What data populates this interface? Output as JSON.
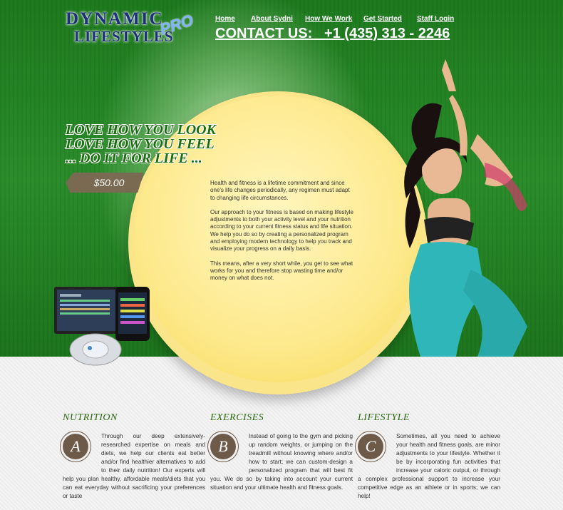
{
  "logo": {
    "line1": "DYNAMIC",
    "line2": "LIFESTYLES",
    "accent": "PRO"
  },
  "nav": {
    "items": [
      "Home",
      "About Sydni",
      "How We Work",
      "Get Started",
      "Staff Login"
    ]
  },
  "contact": "CONTACT US:   +1 (435) 313 - 2246",
  "tagline": [
    "LOVE HOW YOU LOOK",
    "LOVE HOW YOU FEEL",
    "... DO IT FOR LIFE ..."
  ],
  "price": "$50.00",
  "intro": [
    "Health and fitness is a lifetime commitment and since one's life changes periodically, any regimen must adapt to changing life circumstances.",
    "Our approach to your fitness is based on making lifestyle adjustments to both your activity level and your nutrition according to your current fitness status and life situation. We help you do so by creating a personalized program and employing modern technology to help you track and visualize your progress on a daily basis.",
    "This means, after a very short while, you get to see what works for you and therefore stop wasting time and/or money on what does not."
  ],
  "columns": [
    {
      "title": "NUTRITION",
      "letter": "A",
      "text": "Through our deep extensively-researched expertise on meals and diets, we help our clients eat better and/or find healthier alternatives to add to their daily nutrition! Our experts will help you plan healthy, affordable meals/diets that you can eat everyday without sacrificing your preferences or taste"
    },
    {
      "title": "EXERCISES",
      "letter": "B",
      "text": "Instead of going to the gym and picking up random weights, or jumping on the treadmill without knowing where and/or how to start; we can custom-design a personalized program that will best fit you. We do so by taking into account your current situation and your ultimate health and fitness goals."
    },
    {
      "title": "LIFESTYLE",
      "letter": "C",
      "text": "Sometimes, all you need to achieve your health and fitness goals, are minor adjustments to your lifestyle. Whether it be by incorporating fun activities that increase your caloric output, or through a complex professional support to increase your competitive edge as an athlete or in sports; we can help!"
    }
  ],
  "colors": {
    "green": "#2a8d2a",
    "yellow": "#fde98b",
    "brown": "#6e5a48",
    "navy": "#1b2f7a"
  }
}
